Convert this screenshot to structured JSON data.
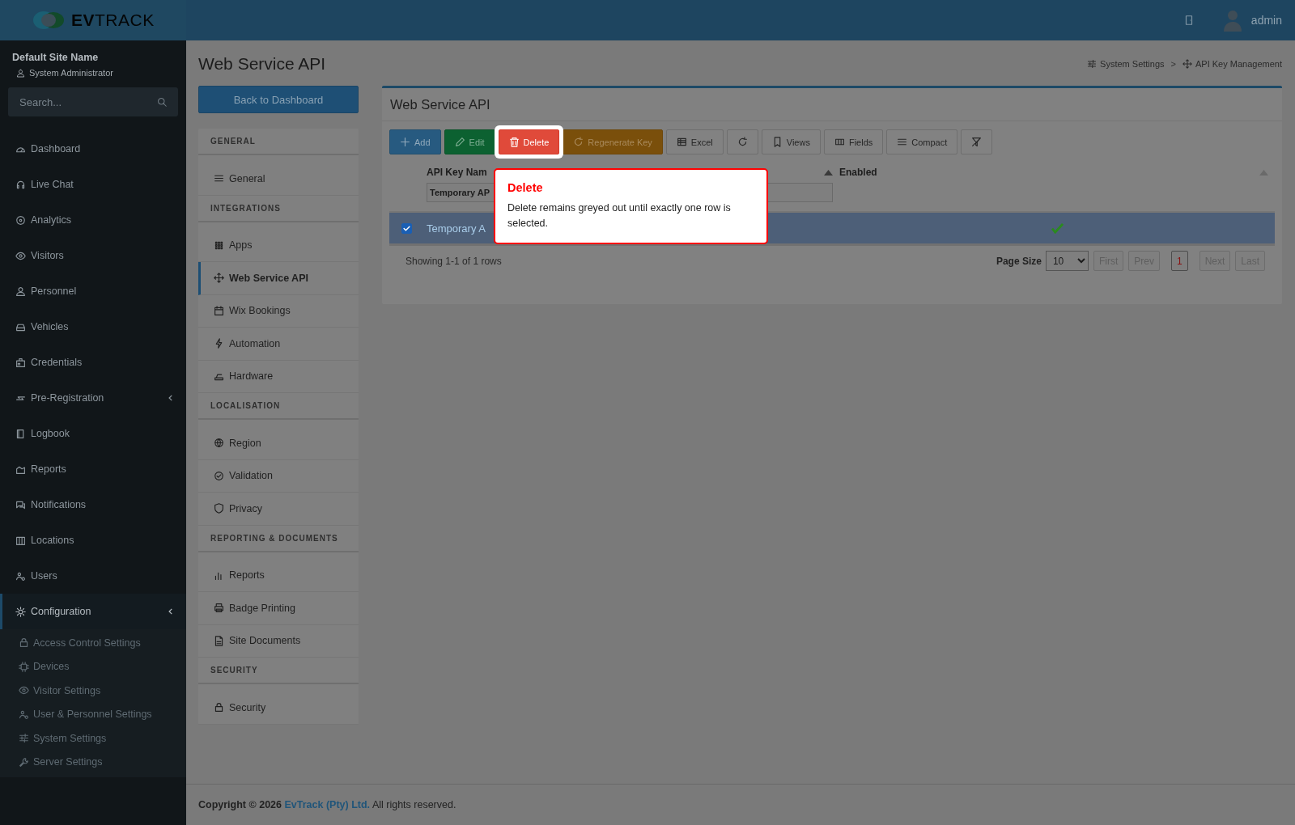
{
  "header": {
    "logo_bold": "EV",
    "logo_light": "TRACK",
    "user": "admin"
  },
  "sidebar": {
    "site_name": "Default Site Name",
    "role": "System Administrator",
    "search": {
      "placeholder": "Search..."
    },
    "items": [
      {
        "label": "Dashboard",
        "selected": false,
        "expandable": false
      },
      {
        "label": "Live Chat",
        "selected": false,
        "expandable": false
      },
      {
        "label": "Analytics",
        "selected": false,
        "expandable": false
      },
      {
        "label": "Visitors",
        "selected": false,
        "expandable": false
      },
      {
        "label": "Personnel",
        "selected": false,
        "expandable": false
      },
      {
        "label": "Vehicles",
        "selected": false,
        "expandable": false
      },
      {
        "label": "Credentials",
        "selected": false,
        "expandable": false
      },
      {
        "label": "Pre-Registration",
        "selected": false,
        "expandable": true
      },
      {
        "label": "Logbook",
        "selected": false,
        "expandable": false
      },
      {
        "label": "Reports",
        "selected": false,
        "expandable": false
      },
      {
        "label": "Notifications",
        "selected": false,
        "expandable": false
      },
      {
        "label": "Locations",
        "selected": false,
        "expandable": false
      },
      {
        "label": "Users",
        "selected": false,
        "expandable": false
      },
      {
        "label": "Configuration",
        "selected": true,
        "expandable": true,
        "children": [
          {
            "label": "Access Control Settings"
          },
          {
            "label": "Devices"
          },
          {
            "label": "Visitor Settings"
          },
          {
            "label": "User & Personnel Settings"
          },
          {
            "label": "System Settings"
          },
          {
            "label": "Server Settings"
          }
        ]
      }
    ]
  },
  "page": {
    "title": "Web Service API",
    "back_button": "Back to Dashboard",
    "breadcrumb": {
      "items": [
        "System Settings",
        "API Key Management"
      ],
      "separator": ">"
    }
  },
  "settings_menu": [
    {
      "title": "GENERAL",
      "items": [
        {
          "label": "General",
          "selected": false
        }
      ]
    },
    {
      "title": "INTEGRATIONS",
      "items": [
        {
          "label": "Apps",
          "selected": false
        },
        {
          "label": "Web Service API",
          "selected": true
        },
        {
          "label": "Wix Bookings",
          "selected": false
        },
        {
          "label": "Automation",
          "selected": false
        },
        {
          "label": "Hardware",
          "selected": false
        }
      ]
    },
    {
      "title": "LOCALISATION",
      "items": [
        {
          "label": "Region",
          "selected": false
        },
        {
          "label": "Validation",
          "selected": false
        },
        {
          "label": "Privacy",
          "selected": false
        }
      ]
    },
    {
      "title": "REPORTING & DOCUMENTS",
      "items": [
        {
          "label": "Reports",
          "selected": false
        },
        {
          "label": "Badge Printing",
          "selected": false
        },
        {
          "label": "Site Documents",
          "selected": false
        }
      ]
    },
    {
      "title": "SECURITY",
      "items": [
        {
          "label": "Security",
          "selected": false
        }
      ]
    }
  ],
  "panel": {
    "title": "Web Service API",
    "toolbar": [
      {
        "kind": "add",
        "label": "Add",
        "highlighted": false
      },
      {
        "kind": "edit",
        "label": "Edit",
        "highlighted": false
      },
      {
        "kind": "delete",
        "label": "Delete",
        "highlighted": true
      },
      {
        "kind": "regenerate",
        "label": "Regenerate Key",
        "highlighted": false
      },
      {
        "kind": "excel",
        "label": "Excel",
        "highlighted": false
      },
      {
        "kind": "refresh",
        "highlighted": false
      },
      {
        "kind": "views",
        "label": "Views",
        "highlighted": false
      },
      {
        "kind": "fields",
        "label": "Fields",
        "highlighted": false
      },
      {
        "kind": "compact",
        "label": "Compact",
        "highlighted": false
      },
      {
        "kind": "clear_filter",
        "highlighted": false
      }
    ],
    "table": {
      "columns": [
        {
          "label": "API Key Nam",
          "filter": "Temporary AP"
        },
        {
          "label": "Enabled"
        }
      ],
      "rows": [
        {
          "selected": true,
          "name": "Temporary A",
          "enabled": true
        }
      ]
    },
    "summary": "Showing 1-1 of 1 rows",
    "page_size": {
      "label": "Page Size",
      "value": "10"
    },
    "pager": [
      {
        "label": "First",
        "selected": false
      },
      {
        "label": "Prev",
        "selected": false
      },
      {
        "label": "1",
        "selected": true
      },
      {
        "label": "Next",
        "selected": false
      },
      {
        "label": "Last",
        "selected": false
      }
    ]
  },
  "tooltip": {
    "title": "Delete",
    "text": "Delete remains greyed out until exactly one row is selected."
  },
  "footer": {
    "start": "**Copyright © 2026**",
    "link": "EvTrack (Pty) Ltd.",
    "end": "All rights reserved."
  }
}
